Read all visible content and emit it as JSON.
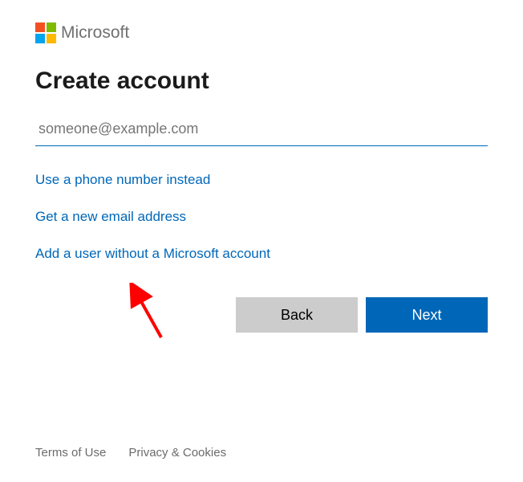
{
  "brand": {
    "name": "Microsoft"
  },
  "heading": "Create account",
  "email": {
    "placeholder": "someone@example.com",
    "value": ""
  },
  "links": {
    "phone": "Use a phone number instead",
    "newEmail": "Get a new email address",
    "noAccount": "Add a user without a Microsoft account"
  },
  "buttons": {
    "back": "Back",
    "next": "Next"
  },
  "footer": {
    "terms": "Terms of Use",
    "privacy": "Privacy & Cookies"
  }
}
